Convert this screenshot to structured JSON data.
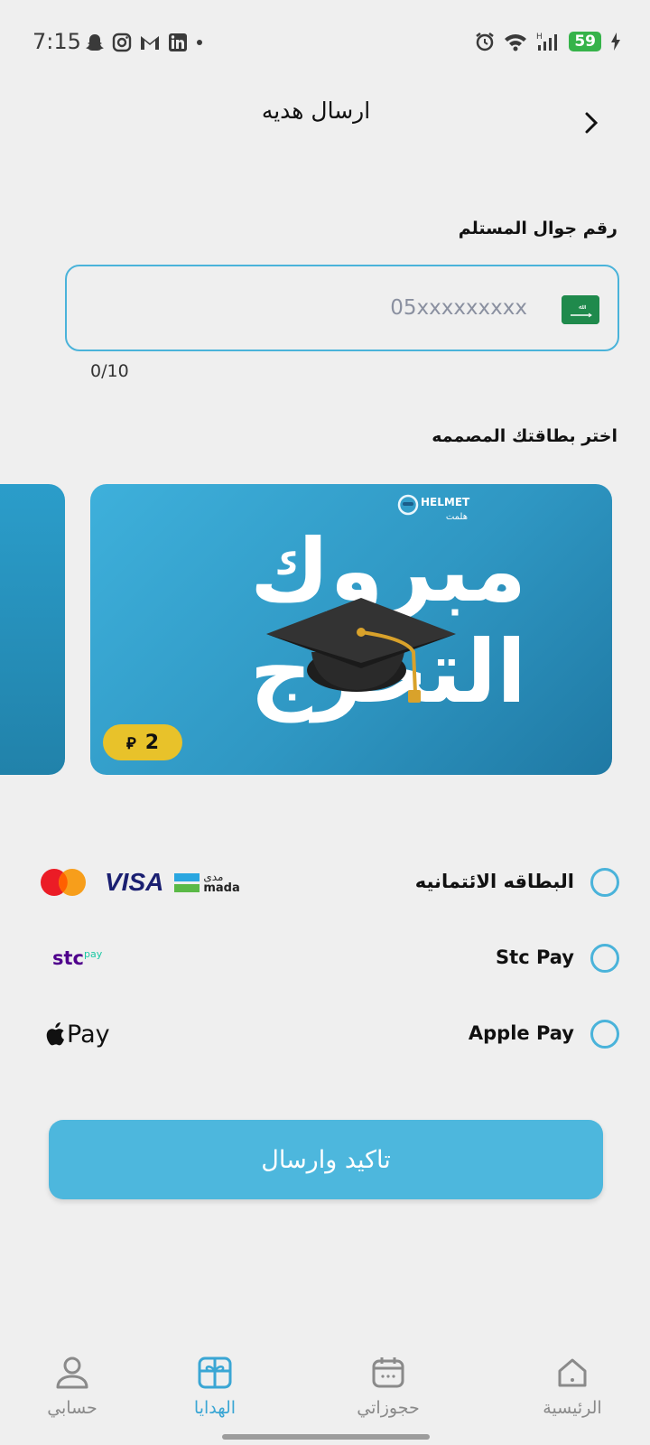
{
  "status_bar": {
    "time": "7:15",
    "battery": "59",
    "left_icons": [
      "snapchat-icon",
      "instagram-icon",
      "gmail-icon",
      "linkedin-icon",
      "dot-icon"
    ],
    "right_icons": [
      "alarm-icon",
      "wifi-icon",
      "signal-icon",
      "battery-icon",
      "charging-icon"
    ]
  },
  "header": {
    "title": "ارسال هديه",
    "back_icon": "chevron-right-icon"
  },
  "recipient": {
    "label": "رقم جوال المستلم",
    "placeholder": "05xxxxxxxxx",
    "value": "",
    "counter": "0/10"
  },
  "card_section": {
    "label": "اختر بطاقتك المصممه",
    "card": {
      "logo_text": "HELMET",
      "logo_subtext": "هلمت",
      "text_line_1": "مبروك",
      "text_line_2": "التخرج",
      "price": "2",
      "currency_symbol": "⃁",
      "background_color": "#2f97c3",
      "badge_color": "#e8c22a"
    }
  },
  "payment_methods": [
    {
      "label": "البطاقه الائتمانيه",
      "selected": false,
      "logos": [
        "mastercard-logo",
        "visa-logo",
        "mada-logo"
      ],
      "visa_text": "VISA",
      "mada_text": "mada",
      "mada_ar": "مدى"
    },
    {
      "label": "Stc Pay",
      "selected": false,
      "logos": [
        "stc-pay-logo"
      ],
      "logo_text": "stc",
      "logo_sub": "pay"
    },
    {
      "label": "Apple Pay",
      "selected": false,
      "logos": [
        "apple-pay-logo"
      ],
      "logo_text": "Pay"
    }
  ],
  "confirm_button": {
    "label": "تاكيد وارسال",
    "color": "#4db7dd"
  },
  "bottom_nav": {
    "items": [
      {
        "label": "الرئيسية",
        "icon": "home-icon",
        "active": false
      },
      {
        "label": "حجوزاتي",
        "icon": "calendar-icon",
        "active": false
      },
      {
        "label": "الهدايا",
        "icon": "gift-icon",
        "active": true
      },
      {
        "label": "حسابي",
        "icon": "user-icon",
        "active": false
      }
    ],
    "active_color": "#3aa6d4"
  }
}
